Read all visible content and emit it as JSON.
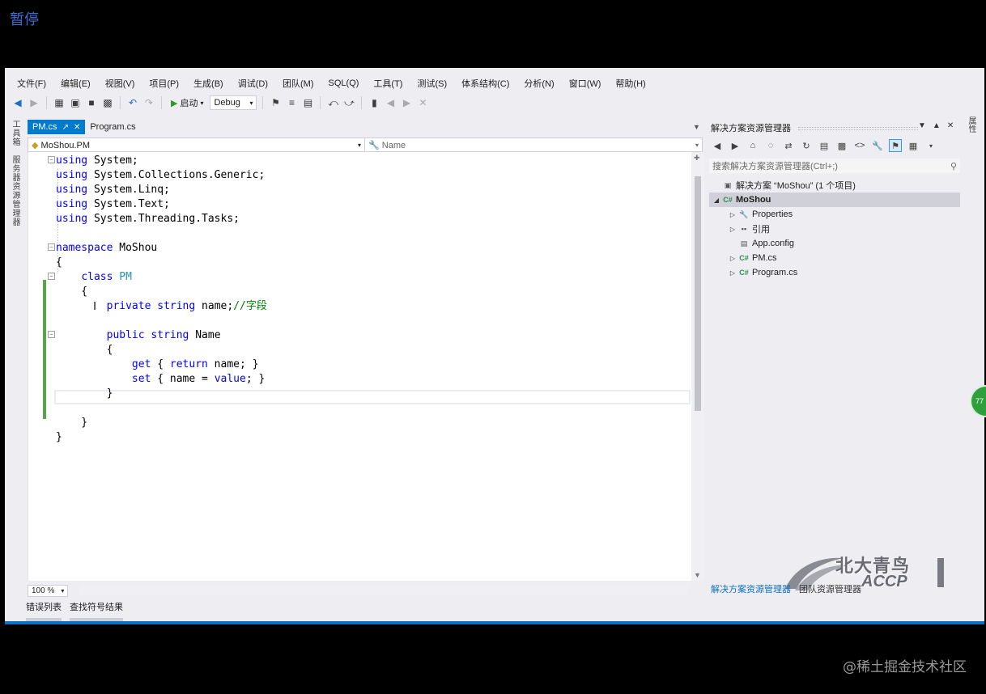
{
  "overlay": {
    "pause_label": "暂停",
    "watermark": "@稀土掘金技术社区"
  },
  "menu": [
    "文件(F)",
    "编辑(E)",
    "视图(V)",
    "项目(P)",
    "生成(B)",
    "调试(D)",
    "团队(M)",
    "SQL(Q)",
    "工具(T)",
    "测试(S)",
    "体系结构(C)",
    "分析(N)",
    "窗口(W)",
    "帮助(H)"
  ],
  "toolbar": {
    "start_label": "启动",
    "config_value": "Debug"
  },
  "left_strip": {
    "toolbox": "工具箱",
    "server_explorer": "服务器资源管理器"
  },
  "tabs": [
    {
      "label": "PM.cs",
      "active": true
    },
    {
      "label": "Program.cs",
      "active": false
    }
  ],
  "navbar": {
    "type_selector": "MoShou.PM",
    "member_selector": "Name"
  },
  "code": [
    "using System;",
    "using System.Collections.Generic;",
    "using System.Linq;",
    "using System.Text;",
    "using System.Threading.Tasks;",
    "",
    "namespace MoShou",
    "{",
    "    class PM",
    "    {",
    "        private string name;//字段",
    "",
    "        public string Name",
    "        {",
    "            get { return name; }",
    "            set { name = value; }",
    "        }",
    "",
    "    }",
    "}"
  ],
  "editor": {
    "zoom": "100 %"
  },
  "bottom_tabs": [
    "错误列表",
    "查找符号结果"
  ],
  "solution_explorer": {
    "title": "解决方案资源管理器",
    "search_placeholder": "搜索解决方案资源管理器(Ctrl+;)",
    "tree": [
      {
        "label": "解决方案 “MoShou” (1 个项目)",
        "level": 0,
        "icon": "solution-icon",
        "arrow": ""
      },
      {
        "label": "MoShou",
        "level": 0,
        "icon": "csharp-project-icon",
        "arrow": "expanded",
        "selected": true
      },
      {
        "label": "Properties",
        "level": 1,
        "icon": "wrench-icon",
        "arrow": "collapsed"
      },
      {
        "label": "引用",
        "level": 1,
        "icon": "references-icon",
        "arrow": "collapsed"
      },
      {
        "label": "App.config",
        "level": 1,
        "icon": "config-file-icon",
        "arrow": ""
      },
      {
        "label": "PM.cs",
        "level": 1,
        "icon": "csharp-file-icon",
        "arrow": "collapsed"
      },
      {
        "label": "Program.cs",
        "level": 1,
        "icon": "csharp-file-icon",
        "arrow": "collapsed"
      }
    ],
    "bottom_tabs": [
      "解决方案资源管理器",
      "团队资源管理器"
    ]
  },
  "right_strip": {
    "properties": "属性"
  },
  "logo": {
    "text": "北大青鸟",
    "sub": "ACCP"
  },
  "colors": {
    "accent": "#007acc",
    "change_bar": "#57a64a",
    "keyword": "#0000ff",
    "type": "#2b91af",
    "comment": "#008000"
  }
}
